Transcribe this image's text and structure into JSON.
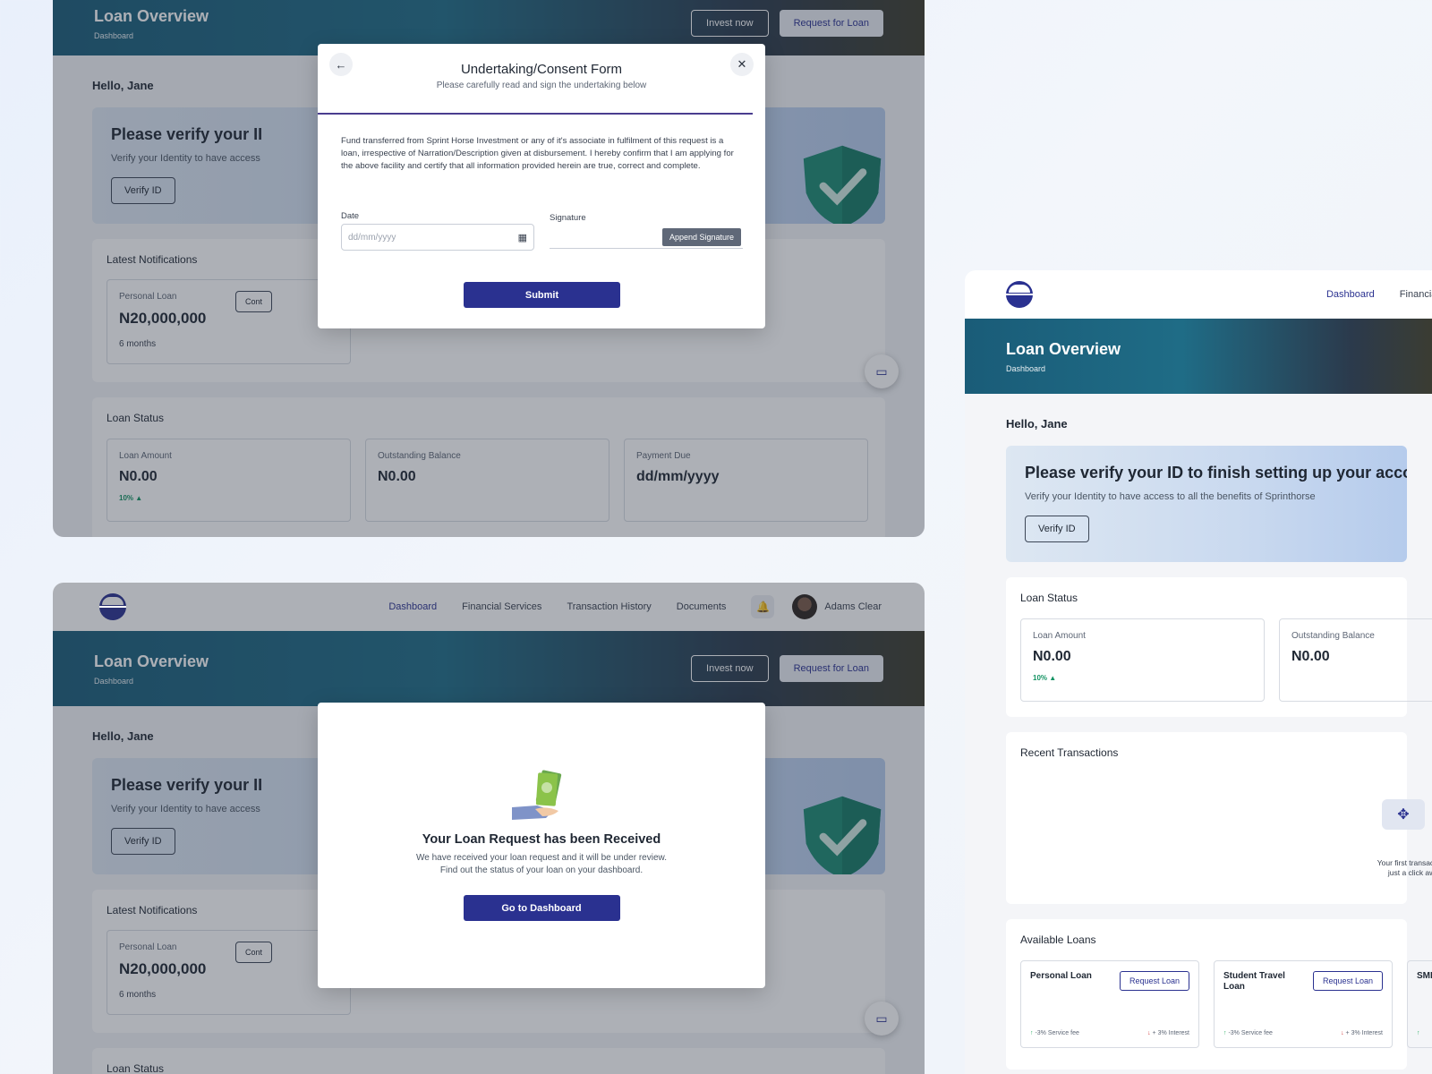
{
  "nav": {
    "links": [
      "Dashboard",
      "Financial Services",
      "Transaction History",
      "Documents"
    ],
    "user_name": "Adams Clear",
    "partial_link": "Financial Ser"
  },
  "banner": {
    "title": "Loan Overview",
    "crumb": "Dashboard",
    "invest_label": "Invest now",
    "request_label": "Request for Loan"
  },
  "greeting": "Hello, Jane",
  "verify": {
    "title": "Please verify your ID to finish setting up your account",
    "title_partial": "Please verify your II",
    "title_partial_f3": "Please verify your ID to finish setting up your accoun",
    "text": "Verify your Identity to have access to all the benefits of Sprinthorse",
    "text_partial": "Verify your Identity to have access",
    "button": "Verify ID"
  },
  "notifications": {
    "title": "Latest Notifications",
    "card_label": "Personal Loan",
    "card_value": "N20,000,000",
    "card_term": "6 months",
    "card_button_partial": "Cont"
  },
  "loan_status": {
    "title": "Loan Status",
    "items": [
      {
        "label": "Loan Amount",
        "value": "N0.00",
        "change": "10%"
      },
      {
        "label": "Outstanding Balance",
        "value": "N0.00"
      },
      {
        "label": "Payment Due",
        "value": "dd/mm/yyyy"
      }
    ]
  },
  "consent_modal": {
    "title": "Undertaking/Consent Form",
    "subtitle": "Please carefully read and sign the undertaking below",
    "body": "Fund transferred from Sprint Horse Investment or any of it's associate in fulfilment of this request is a loan, irrespective of Narration/Description given at disbursement. I hereby confirm that I am applying for the above facility and certify that all information provided herein are true, correct and complete.",
    "date_label": "Date",
    "date_placeholder": "dd/mm/yyyy",
    "signature_label": "Signature",
    "append_label": "Append Signature",
    "submit_label": "Submit",
    "icons": {
      "back": "arrow-left-icon",
      "close": "close-icon",
      "calendar": "calendar-icon"
    }
  },
  "received_modal": {
    "title": "Your Loan Request has been Received",
    "line1": "We have received your loan request and it will be under review.",
    "line2": "Find out the status of your loan on your dashboard.",
    "button": "Go to Dashboard"
  },
  "recent_transactions": {
    "title": "Recent Transactions",
    "empty_line1": "Your first transactior",
    "empty_line2": "just a click away."
  },
  "available_loans": {
    "title": "Available Loans",
    "cards": [
      {
        "name": "Personal Loan",
        "button": "Request Loan",
        "fee": "-3% Service fee",
        "interest": "+ 3% Interest"
      },
      {
        "name": "Student Travel Loan",
        "button": "Request Loan",
        "fee": "-3% Service fee",
        "interest": "+ 3% Interest"
      },
      {
        "name": "SMI"
      }
    ]
  },
  "colors": {
    "brand": "#2a3190",
    "success": "#149363",
    "banner_start": "#1a5c78"
  }
}
